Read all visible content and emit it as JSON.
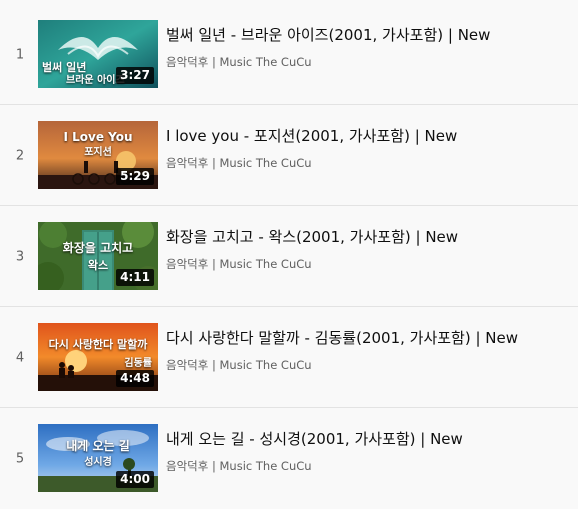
{
  "playlist": {
    "items": [
      {
        "index": "1",
        "title": "벌써 일년 - 브라운 아이즈(2001, 가사포함) | New",
        "channel": "음악덕후 | Music The CuCu",
        "duration": "3:27",
        "thumb_line1": "벌써 일년",
        "thumb_line2": "브라운 아이즈"
      },
      {
        "index": "2",
        "title": "I love you - 포지션(2001, 가사포함) | New",
        "channel": "음악덕후 | Music The CuCu",
        "duration": "5:29",
        "thumb_line1": "I Love You",
        "thumb_line2": "포지션"
      },
      {
        "index": "3",
        "title": "화장을 고치고 - 왁스(2001, 가사포함) | New",
        "channel": "음악덕후 | Music The CuCu",
        "duration": "4:11",
        "thumb_line1": "화장을 고치고",
        "thumb_line2": "왁스"
      },
      {
        "index": "4",
        "title": "다시 사랑한다 말할까 - 김동률(2001, 가사포함) | New",
        "channel": "음악덕후 | Music The CuCu",
        "duration": "4:48",
        "thumb_line1": "다시 사랑한다 말할까",
        "thumb_line2": "김동률"
      },
      {
        "index": "5",
        "title": "내게 오는 길 - 성시경(2001, 가사포함) | New",
        "channel": "음악덕후 | Music The CuCu",
        "duration": "4:00",
        "thumb_line1": "내게 오는 길",
        "thumb_line2": "성시경"
      }
    ]
  }
}
